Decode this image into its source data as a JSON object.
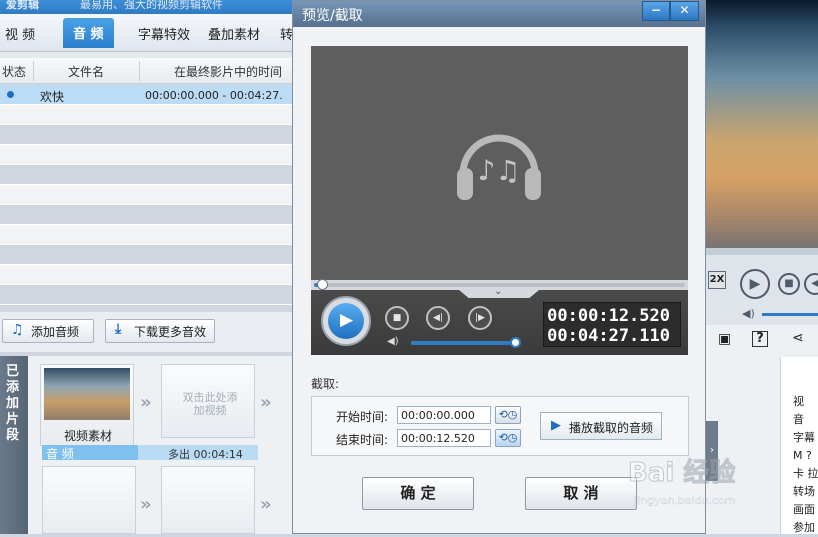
{
  "app": {
    "title": "爱剪辑",
    "slogan": "最易用、强大的视频剪辑软件"
  },
  "tabs": [
    "视 频",
    "音 频",
    "字幕特效",
    "叠加素材",
    "转"
  ],
  "active_tab": "音 频",
  "audio_list": {
    "columns": [
      "状态",
      "文件名",
      "在最终影片中的时间"
    ],
    "rows": [
      {
        "name": "欢快",
        "time": "00:00:00.000 - 00:04:27."
      }
    ]
  },
  "toolbar": {
    "add_audio": "添加音频",
    "download_more": "下载更多音效"
  },
  "added_clips": {
    "label": "已添加片段",
    "clip1_label": "视频素材",
    "placeholder": "双击此处添加视频",
    "audio_track_label": "音 频",
    "audio_track_extra": "多出 00:04:14"
  },
  "right_panel": {
    "speed": "2X",
    "list": [
      "视",
      "音",
      "字幕",
      "M ?",
      "卡 拉",
      "转场",
      "画面",
      "参加"
    ]
  },
  "dialog": {
    "title": "预览/截取",
    "minimize": "−",
    "close": "✕",
    "current_time": "00:00:12.520",
    "total_time": "00:04:27.110",
    "progress": 0.005,
    "volume": 1.0,
    "cut_label": "截取:",
    "start_label": "开始时间:",
    "start_value": "00:00:00.000",
    "end_label": "结束时间:",
    "end_value": "00:00:12.520",
    "play_cut": "播放截取的音频",
    "ok": "确 定",
    "cancel": "取 消"
  },
  "watermark": {
    "logo": "Bai 经验",
    "url": "jingyan.baidu.com"
  },
  "colors": {
    "accent": "#2a7fcc",
    "player_bg": "#5e5e5e",
    "selected_row": "#bcdcf6"
  }
}
